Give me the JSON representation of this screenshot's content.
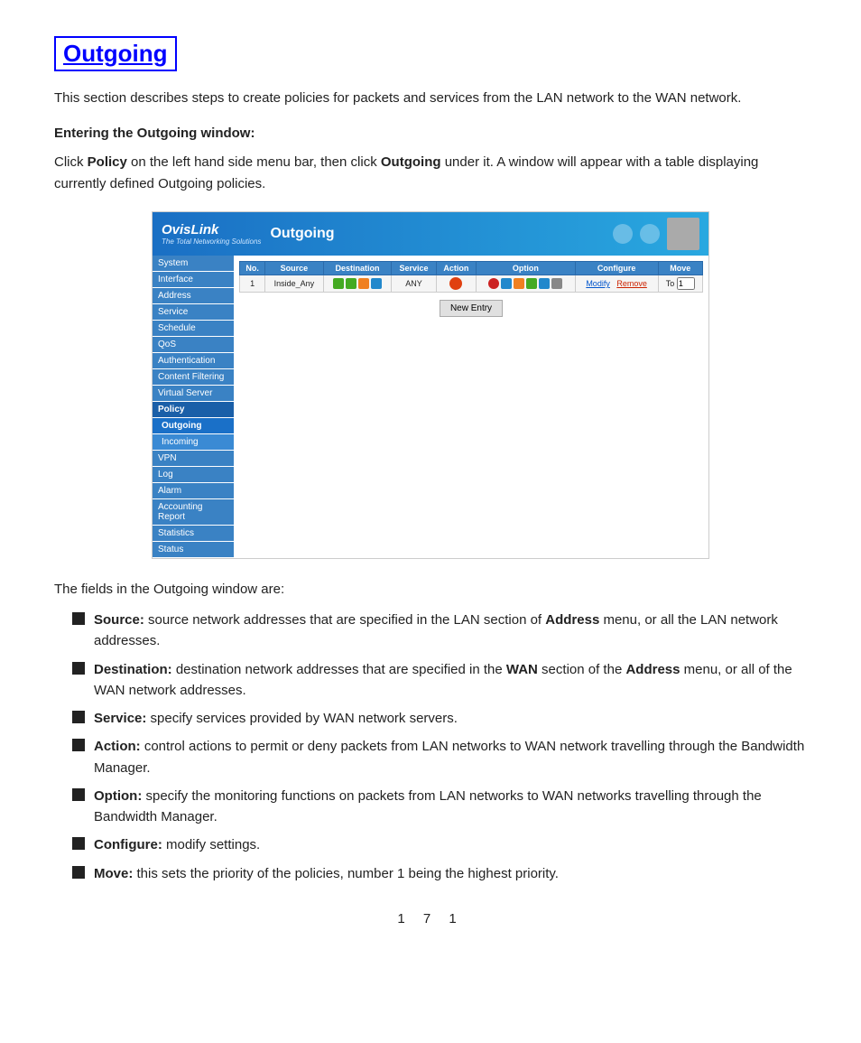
{
  "page": {
    "title": "Outgoing",
    "intro": "This section describes steps to create policies for packets and services from the LAN network to the WAN network.",
    "section_heading": "Entering the Outgoing window:",
    "click_instruction_1": "Click ",
    "click_bold_1": "Policy",
    "click_instruction_2": " on the left hand side menu bar, then click ",
    "click_bold_2": "Outgoing",
    "click_instruction_3": " under it.    A window will appear with a table displaying currently defined Outgoing policies.",
    "fields_intro": "The fields in the Outgoing window are:",
    "page_number": "1 7 1"
  },
  "screenshot": {
    "header": {
      "logo_top": "OvisLink",
      "logo_sub": "The Total Networking Solutions",
      "title": "Outgoing"
    },
    "sidebar": {
      "items": [
        {
          "label": "System",
          "type": "normal"
        },
        {
          "label": "Interface",
          "type": "normal"
        },
        {
          "label": "Address",
          "type": "normal"
        },
        {
          "label": "Service",
          "type": "normal"
        },
        {
          "label": "Schedule",
          "type": "normal"
        },
        {
          "label": "QoS",
          "type": "normal"
        },
        {
          "label": "Authentication",
          "type": "normal"
        },
        {
          "label": "Content Filtering",
          "type": "normal"
        },
        {
          "label": "Virtual Server",
          "type": "normal"
        },
        {
          "label": "Policy",
          "type": "section"
        },
        {
          "label": "Outgoing",
          "type": "sub-active"
        },
        {
          "label": "Incoming",
          "type": "sub"
        },
        {
          "label": "VPN",
          "type": "normal"
        },
        {
          "label": "Log",
          "type": "normal"
        },
        {
          "label": "Alarm",
          "type": "normal"
        },
        {
          "label": "Accounting Report",
          "type": "normal"
        },
        {
          "label": "Statistics",
          "type": "normal"
        },
        {
          "label": "Status",
          "type": "normal"
        }
      ]
    },
    "table": {
      "headers": [
        "No.",
        "Source",
        "Destination",
        "Service",
        "Action",
        "Option",
        "Configure",
        "Move"
      ],
      "row": {
        "no": "1",
        "source": "Inside_Any",
        "destination": "",
        "service": "ANY",
        "action": "deny",
        "configure_modify": "Modify",
        "configure_remove": "Remove",
        "move_to": "To",
        "move_num": "1"
      }
    },
    "new_entry_button": "New Entry"
  },
  "bullets": [
    {
      "bold": "Source:",
      "text": " source network addresses that are specified in the LAN section of ",
      "bold2": "Address",
      "text2": " menu, or all the LAN network addresses."
    },
    {
      "bold": "Destination:",
      "text": " destination network addresses that are specified in the ",
      "bold2": "WAN",
      "text2": " section of the ",
      "bold3": "Address",
      "text3": " menu, or all of the WAN network addresses."
    },
    {
      "bold": "Service:",
      "text": " specify services provided by WAN network servers.",
      "bold2": "",
      "text2": ""
    },
    {
      "bold": "Action:",
      "text": " control actions to permit or deny packets from LAN networks to WAN network travelling through the Bandwidth Manager.",
      "bold2": "",
      "text2": ""
    },
    {
      "bold": "Option:",
      "text": " specify the monitoring functions on packets from LAN networks to WAN networks travelling through the Bandwidth Manager.",
      "bold2": "",
      "text2": ""
    },
    {
      "bold": " Configure:",
      "text": " modify settings.",
      "bold2": "",
      "text2": ""
    },
    {
      "bold": " Move:",
      "text": " this sets the priority of the policies, number 1 being the highest priority.",
      "bold2": "",
      "text2": ""
    }
  ]
}
